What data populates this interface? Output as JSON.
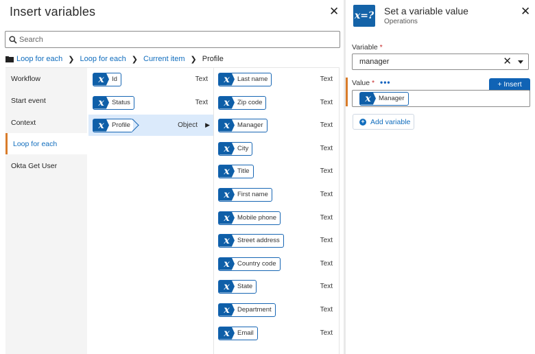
{
  "insert_panel": {
    "title": "Insert variables",
    "search_placeholder": "Search",
    "breadcrumb": [
      "Loop for each",
      "Loop for each",
      "Current item",
      "Profile"
    ],
    "categories": [
      "Workflow",
      "Start event",
      "Context",
      "Loop for each",
      "Okta Get User"
    ],
    "active_category": "Loop for each",
    "middle_items": [
      {
        "label": "Id",
        "type": "Text"
      },
      {
        "label": "Status",
        "type": "Text"
      },
      {
        "label": "Profile",
        "type": "Object"
      }
    ],
    "selected_item": "Profile",
    "profile_fields": [
      {
        "label": "Last name",
        "type": "Text"
      },
      {
        "label": "Zip code",
        "type": "Text"
      },
      {
        "label": "Manager",
        "type": "Text"
      },
      {
        "label": "City",
        "type": "Text"
      },
      {
        "label": "Title",
        "type": "Text"
      },
      {
        "label": "First name",
        "type": "Text"
      },
      {
        "label": "Mobile phone",
        "type": "Text"
      },
      {
        "label": "Street address",
        "type": "Text"
      },
      {
        "label": "Country code",
        "type": "Text"
      },
      {
        "label": "State",
        "type": "Text"
      },
      {
        "label": "Department",
        "type": "Text"
      },
      {
        "label": "Email",
        "type": "Text"
      }
    ]
  },
  "action_panel": {
    "icon_text": "x=?",
    "title": "Set a variable value",
    "subtitle": "Operations",
    "variable_label": "Variable",
    "variable_value": "manager",
    "value_label": "Value",
    "more_dots": "•••",
    "insert_button": "+ Insert",
    "value_pill": "Manager",
    "add_variable_button": "Add variable"
  },
  "pill_glyph": "x",
  "required_mark": "*",
  "colors": {
    "accent_blue": "#0f5fa8",
    "link_blue": "#0f6cbd",
    "active_orange": "#d97c2b",
    "selected_row": "#dbeafb"
  }
}
